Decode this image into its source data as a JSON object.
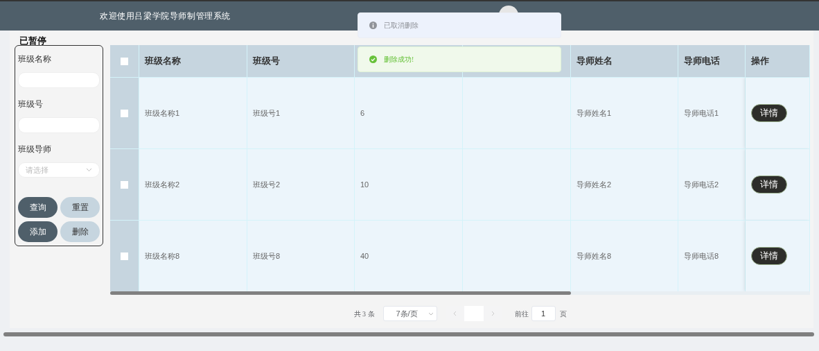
{
  "header": {
    "title": "欢迎使用吕梁学院导师制管理系统"
  },
  "status_label": "已暂停",
  "filter": {
    "fields": [
      {
        "label": "班级名称",
        "kind": "input"
      },
      {
        "label": "班级号",
        "kind": "input"
      },
      {
        "label": "班级导师",
        "kind": "select",
        "placeholder": "请选择"
      }
    ],
    "buttons": [
      {
        "label": "查询",
        "kind": "primary"
      },
      {
        "label": "重置",
        "kind": "secondary"
      },
      {
        "label": "添加",
        "kind": "primary"
      },
      {
        "label": "删除",
        "kind": "secondary"
      }
    ]
  },
  "table": {
    "all_checked": false,
    "columns": [
      {
        "kind": "text",
        "label": "班级名称"
      },
      {
        "kind": "text",
        "label": "班级号"
      },
      {
        "kind": "text"
      },
      {
        "kind": "text"
      },
      {
        "kind": "text",
        "label": "导师姓名"
      },
      {
        "kind": "text",
        "label": "导师电话"
      },
      {
        "kind": "action",
        "label": "操作"
      }
    ],
    "rows": [
      {
        "checked": false,
        "cells": [
          "班级名称1",
          "班级号1",
          "6",
          null,
          "导师姓名1",
          "导师电话1",
          "详情"
        ]
      },
      {
        "checked": false,
        "cells": [
          "班级名称2",
          "班级号2",
          "10",
          null,
          "导师姓名2",
          "导师电话2",
          "详情"
        ]
      },
      {
        "checked": false,
        "cells": [
          "班级名称8",
          "班级号8",
          "40",
          null,
          "导师姓名8",
          "导师电话8",
          "详情"
        ]
      }
    ]
  },
  "pagination": {
    "total": "共 3 条",
    "page_size": "7条/页",
    "goto_label": "前往",
    "goto_value": "1",
    "page_suffix": "页"
  },
  "toasts": [
    {
      "kind": "info",
      "text": "已取消删除"
    },
    {
      "kind": "success",
      "text": "删除成功!"
    }
  ]
}
